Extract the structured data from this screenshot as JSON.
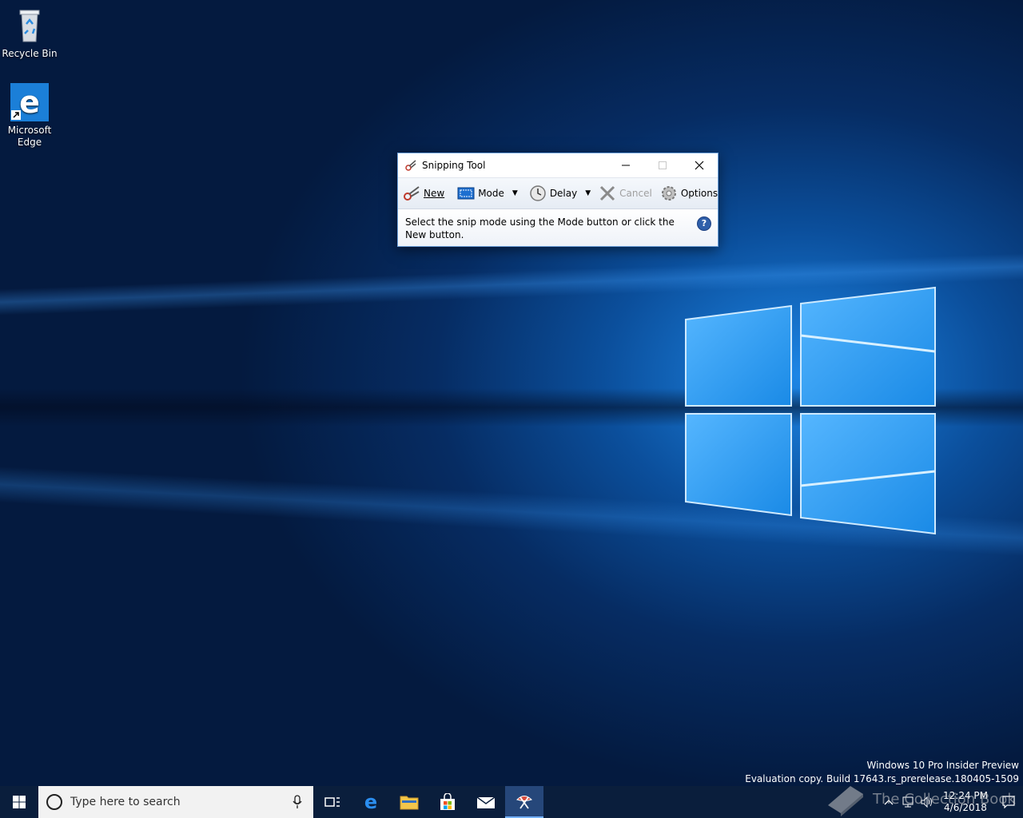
{
  "desktop": {
    "icons": [
      {
        "label": "Recycle Bin"
      },
      {
        "label": "Microsoft Edge"
      }
    ],
    "watermark_line1": "Windows 10 Pro Insider Preview",
    "watermark_line2": "Evaluation copy. Build 17643.rs_prerelease.180405-1509",
    "overlay_watermark": "The Collection Book"
  },
  "snipping_tool": {
    "title": "Snipping Tool",
    "toolbar": {
      "new_label": "New",
      "mode_label": "Mode",
      "delay_label": "Delay",
      "cancel_label": "Cancel",
      "options_label": "Options"
    },
    "message": "Select the snip mode using the Mode button or click the New button.",
    "help_label": "?"
  },
  "taskbar": {
    "search_placeholder": "Type here to search",
    "clock_time": "12:24 PM",
    "clock_date": "4/6/2018"
  },
  "colors": {
    "taskbar_bg": "#0a1e3c",
    "accent": "#0078d7"
  }
}
